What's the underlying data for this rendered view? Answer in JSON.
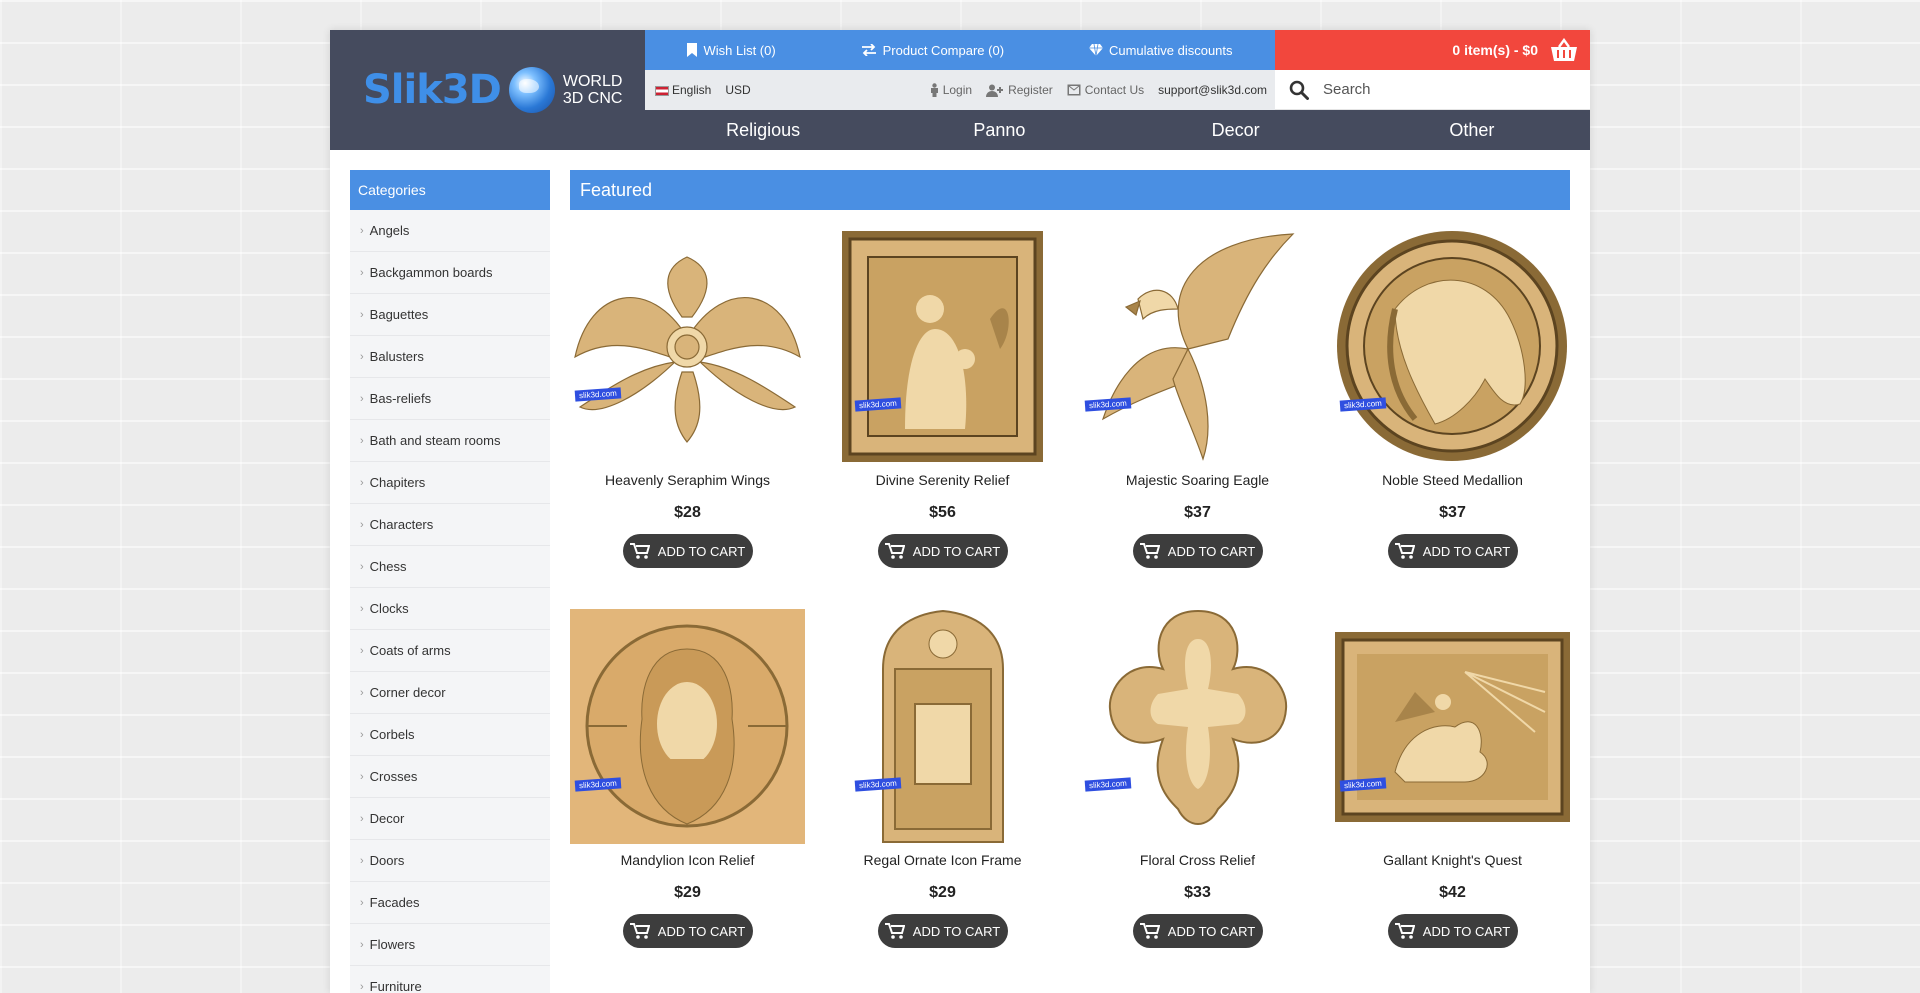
{
  "header": {
    "logo_text": "Slik3D",
    "logo_sub_line1": "WORLD",
    "logo_sub_line2": "3D CNC",
    "wishlist": "Wish List (0)",
    "compare": "Product Compare (0)",
    "discounts": "Cumulative discounts",
    "cart": "0 item(s) - $0",
    "language": "English",
    "currency": "USD",
    "login": "Login",
    "register": "Register",
    "contact": "Contact Us",
    "email": "support@slik3d.com",
    "search_placeholder": "Search"
  },
  "nav": [
    "Religious",
    "Panno",
    "Decor",
    "Other"
  ],
  "sidebar": {
    "title": "Categories",
    "items": [
      "Angels",
      "Backgammon boards",
      "Baguettes",
      "Balusters",
      "Bas-reliefs",
      "Bath and steam rooms",
      "Chapiters",
      "Characters",
      "Chess",
      "Clocks",
      "Coats of arms",
      "Corner decor",
      "Corbels",
      "Crosses",
      "Decor",
      "Doors",
      "Facades",
      "Flowers",
      "Furniture"
    ]
  },
  "featured": {
    "title": "Featured",
    "button_label": "ADD TO CART",
    "watermark": "slik3d.com",
    "products": [
      {
        "name": "Heavenly Seraphim Wings",
        "price": "$28",
        "icon": "seraphim-icon"
      },
      {
        "name": "Divine Serenity Relief",
        "price": "$56",
        "icon": "framed-relief-icon"
      },
      {
        "name": "Majestic Soaring Eagle",
        "price": "$37",
        "icon": "eagle-icon"
      },
      {
        "name": "Noble Steed Medallion",
        "price": "$37",
        "icon": "horse-medallion-icon"
      },
      {
        "name": "Mandylion Icon Relief",
        "price": "$29",
        "icon": "mandylion-icon"
      },
      {
        "name": "Regal Ornate Icon Frame",
        "price": "$29",
        "icon": "ornate-frame-icon"
      },
      {
        "name": "Floral Cross Relief",
        "price": "$33",
        "icon": "floral-cross-icon"
      },
      {
        "name": "Gallant Knight's Quest",
        "price": "$42",
        "icon": "knight-relief-icon"
      }
    ]
  },
  "colors": {
    "accent_blue": "#4a8fe3",
    "header_dark": "#454b5e",
    "cart_red": "#f2473d",
    "wood": "#d9b47a"
  }
}
